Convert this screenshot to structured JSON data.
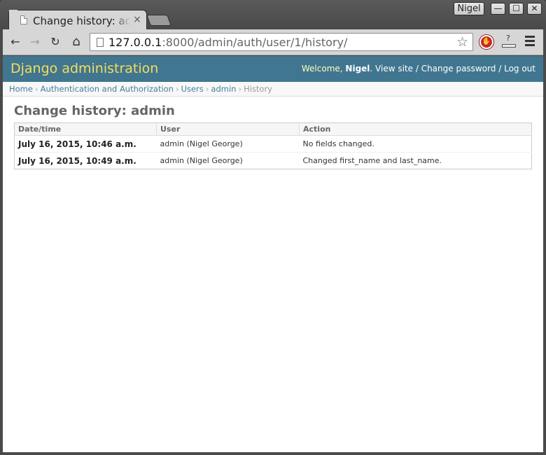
{
  "browser": {
    "tab_title": "Change history: admin",
    "profile_name": "Nigel",
    "close_tab_glyph": "×",
    "url_host": "127.0.0.1",
    "url_rest": ":8000/admin/auth/user/1/history/",
    "window_controls": {
      "minimize": "—",
      "maximize": "☐",
      "close": "✕"
    },
    "nav_glyphs": {
      "back": "←",
      "forward": "→",
      "reload": "↻",
      "home": "⌂",
      "star": "☆"
    },
    "ext_stop_glyph": "✋",
    "ext_dl_glyph": "?"
  },
  "header": {
    "branding": "Django administration",
    "welcome": "Welcome, ",
    "username": "Nigel",
    "dot": ". ",
    "view_site": "View site",
    "sep1": " / ",
    "change_password": "Change password",
    "sep2": " / ",
    "log_out": "Log out"
  },
  "breadcrumbs": {
    "items": [
      "Home",
      "Authentication and Authorization",
      "Users",
      "admin"
    ],
    "current": "History",
    "arrow": "›"
  },
  "page": {
    "title": "Change history: admin"
  },
  "history_table": {
    "columns": [
      "Date/time",
      "User",
      "Action"
    ],
    "rows": [
      {
        "datetime": "July 16, 2015, 10:46 a.m.",
        "user": "admin (Nigel George)",
        "action": "No fields changed."
      },
      {
        "datetime": "July 16, 2015, 10:49 a.m.",
        "user": "admin (Nigel George)",
        "action": "Changed first_name and last_name."
      }
    ]
  },
  "colors": {
    "header_bg": "#417690",
    "branding": "#f5dd5d",
    "link": "#447e9b"
  }
}
